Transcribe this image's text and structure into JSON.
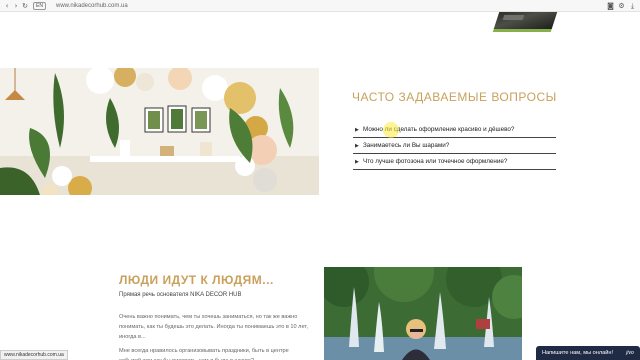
{
  "browser": {
    "address_url": "www.nikadecorhub.com.ua",
    "site_badge": "EN",
    "status_url": "www.nikadecorhub.com.ua"
  },
  "faq": {
    "title": "ЧАСТО ЗАДАВАЕМЫЕ ВОПРОСЫ",
    "items": [
      {
        "question": "Можно ли сделать оформление красиво и дёшево?"
      },
      {
        "question": "Занимаетесь ли Вы шарами?"
      },
      {
        "question": "Что лучше фотозона или точечное оформление?"
      }
    ]
  },
  "people": {
    "title": "ЛЮДИ ИДУТ К ЛЮДЯМ...",
    "subtitle": "Прямая речь основателя NIKA DECOR HUB",
    "paragraph_1": "Очень важно понимать, чем ты хочешь заниматься, но так же важно понимать, как ты будешь это делать. Иногда ты понимаешь это в 10 лет, иногда в...",
    "paragraph_2": "Мне всегда нравилось организовывать праздники, быть в центре событий или как бы рисовать, чем я была в школе?"
  },
  "chat": {
    "label": "Напишите нам, мы онлайн!",
    "logo": "jivo"
  },
  "icons": {
    "back": "arrow-left-icon",
    "forward": "arrow-right-icon",
    "reload": "reload-icon",
    "camera": "camera-icon",
    "settings": "gear-icon",
    "download": "download-icon"
  },
  "colors": {
    "accent_gold": "#c9a15c",
    "chat_bg": "#1f2a44"
  }
}
